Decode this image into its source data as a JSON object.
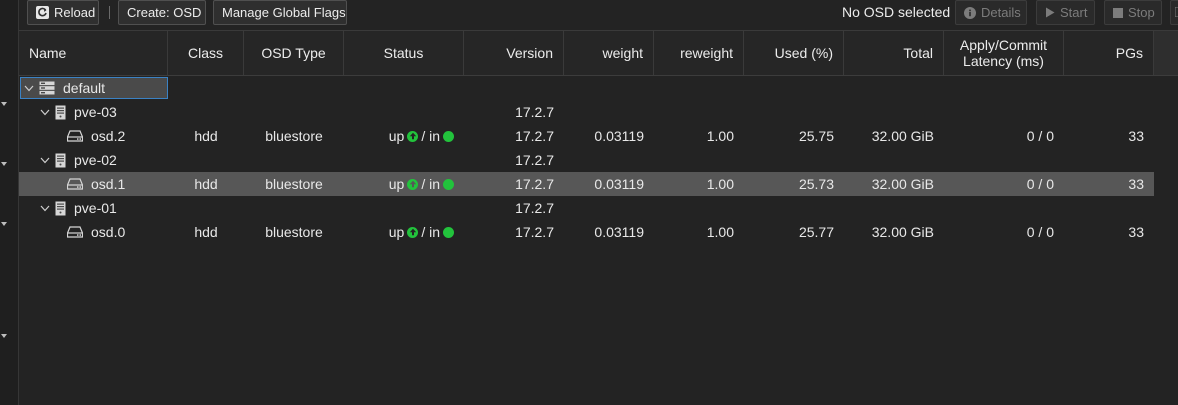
{
  "toolbar": {
    "reload_label": "Reload",
    "create_osd_label": "Create: OSD",
    "manage_flags_label": "Manage Global Flags",
    "selection_status": "No OSD selected",
    "details_label": "Details",
    "start_label": "Start",
    "stop_label": "Stop"
  },
  "columns": {
    "name": "Name",
    "class": "Class",
    "osd_type": "OSD Type",
    "status": "Status",
    "version": "Version",
    "weight": "weight",
    "reweight": "reweight",
    "used": "Used (%)",
    "total": "Total",
    "latency": "Apply/Commit Latency (ms)",
    "pgs": "PGs"
  },
  "tree": {
    "root": {
      "name": "default"
    },
    "hosts": [
      {
        "name": "pve-03",
        "version": "17.2.7",
        "osds": [
          {
            "name": "osd.2",
            "class": "hdd",
            "type": "bluestore",
            "status_up": "up",
            "status_sep": "/ in",
            "version": "17.2.7",
            "weight": "0.03119",
            "reweight": "1.00",
            "used": "25.75",
            "total": "32.00 GiB",
            "latency": "0 / 0",
            "pgs": "33"
          }
        ]
      },
      {
        "name": "pve-02",
        "version": "17.2.7",
        "osds": [
          {
            "name": "osd.1",
            "class": "hdd",
            "type": "bluestore",
            "status_up": "up",
            "status_sep": "/ in",
            "version": "17.2.7",
            "weight": "0.03119",
            "reweight": "1.00",
            "used": "25.73",
            "total": "32.00 GiB",
            "latency": "0 / 0",
            "pgs": "33"
          }
        ]
      },
      {
        "name": "pve-01",
        "version": "17.2.7",
        "osds": [
          {
            "name": "osd.0",
            "class": "hdd",
            "type": "bluestore",
            "status_up": "up",
            "status_sep": "/ in",
            "version": "17.2.7",
            "weight": "0.03119",
            "reweight": "1.00",
            "used": "25.77",
            "total": "32.00 GiB",
            "latency": "0 / 0",
            "pgs": "33"
          }
        ]
      }
    ]
  },
  "colors": {
    "status_green": "#22c33c",
    "selected_row": "#575757",
    "focus_border": "#3b82c4"
  }
}
